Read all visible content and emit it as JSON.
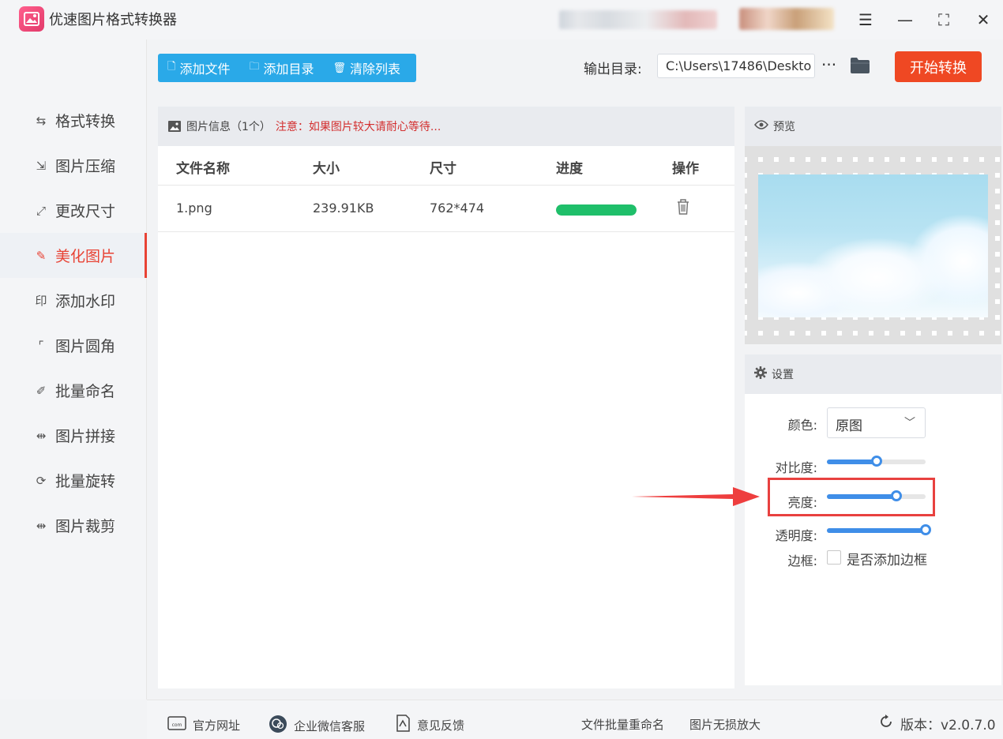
{
  "app": {
    "title": "优速图片格式转换器"
  },
  "window_controls": {
    "menu": "☰",
    "minimize": "—",
    "maximize": "⛶",
    "close": "✕"
  },
  "sidebar": {
    "items": [
      {
        "label": "格式转换",
        "icon": "swap-arrows-icon",
        "glyph": "⇆"
      },
      {
        "label": "图片压缩",
        "icon": "compress-icon",
        "glyph": "⇲"
      },
      {
        "label": "更改尺寸",
        "icon": "resize-icon",
        "glyph": "⤢"
      },
      {
        "label": "美化图片",
        "icon": "beautify-icon",
        "glyph": "✎",
        "active": true
      },
      {
        "label": "添加水印",
        "icon": "watermark-icon",
        "glyph": "印"
      },
      {
        "label": "图片圆角",
        "icon": "rounded-corner-icon",
        "glyph": "⌜"
      },
      {
        "label": "批量命名",
        "icon": "rename-icon",
        "glyph": "✐"
      },
      {
        "label": "图片拼接",
        "icon": "merge-icon",
        "glyph": "⇹"
      },
      {
        "label": "批量旋转",
        "icon": "rotate-icon",
        "glyph": "⟳"
      },
      {
        "label": "图片裁剪",
        "icon": "crop-icon",
        "glyph": "⇹"
      }
    ]
  },
  "toolbar": {
    "add_file": "添加文件",
    "add_folder": "添加目录",
    "clear_list": "清除列表"
  },
  "output": {
    "label": "输出目录:",
    "path": "C:\\Users\\17486\\Deskto",
    "more": "···"
  },
  "start_button": "开始转换",
  "file_list": {
    "header_title": "图片信息（1个）",
    "header_warning": "注意：如果图片较大请耐心等待...",
    "columns": [
      "文件名称",
      "大小",
      "尺寸",
      "进度",
      "操作"
    ],
    "rows": [
      {
        "name": "1.png",
        "size": "239.91KB",
        "dimensions": "762*474",
        "progress": 1.0
      }
    ]
  },
  "preview": {
    "title": "预览"
  },
  "settings": {
    "title": "设置",
    "color_label": "颜色:",
    "color_value": "原图",
    "contrast_label": "对比度:",
    "contrast_value": 0.5,
    "brightness_label": "亮度:",
    "brightness_value": 0.7,
    "opacity_label": "透明度:",
    "opacity_value": 1.0,
    "border_label": "边框:",
    "border_checkbox_label": "是否添加边框",
    "accent_color": "#3f8ee8"
  },
  "footer": {
    "website": "官方网址",
    "wechat": "企业微信客服",
    "feedback": "意见反馈",
    "batch_rename": "文件批量重命名",
    "lossless": "图片无损放大",
    "version": "版本：v2.0.7.0"
  },
  "colors": {
    "accent_red": "#ef4823",
    "toolbar_blue": "#2aa9e8",
    "progress_green": "#1fbf6a",
    "highlight": "#e8413f"
  }
}
